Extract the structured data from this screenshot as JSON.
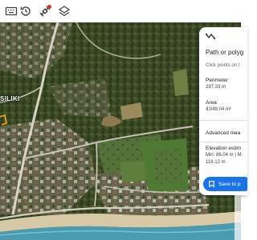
{
  "toolbar": {
    "tools": [
      {
        "name": "keyboard-icon"
      },
      {
        "name": "history-icon"
      },
      {
        "name": "layers-satellite-icon"
      },
      {
        "name": "layers-icon"
      }
    ],
    "new_feature_dot_color": "#d93025"
  },
  "map": {
    "place_label": "SILIKI",
    "view": "satellite"
  },
  "panel": {
    "icon": "path-polygon-icon",
    "title": "Path or polyg",
    "hint": "Click points on t",
    "perimeter": {
      "label": "Perimeter",
      "value": "297.33 m"
    },
    "area": {
      "label": "Area",
      "value": "4,048.04 m²"
    },
    "advanced": {
      "label": "Advanced mea"
    },
    "elevation": {
      "label": "Elevation estim",
      "value_line1": "Min: 86.04 m | M",
      "value_line2": "118.12 m"
    },
    "save_label": "Save to p"
  },
  "colors": {
    "accent": "#1a73e8",
    "polygon_outline": "#f4b400"
  }
}
